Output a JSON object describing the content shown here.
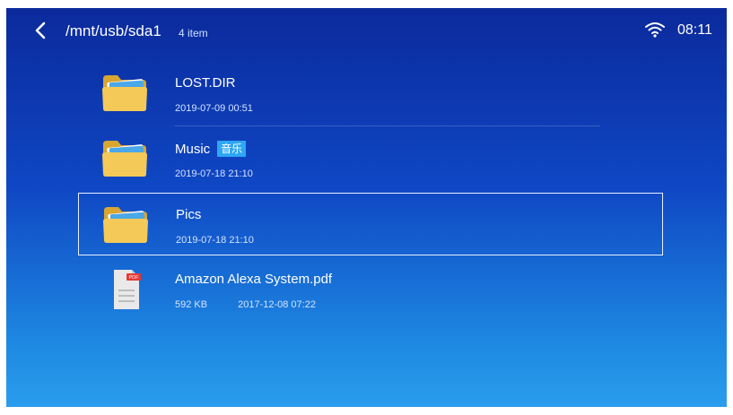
{
  "header": {
    "back_icon": "chevron-left-icon",
    "path": "/mnt/usb/sda1",
    "count": "4 item",
    "wifi_icon": "wifi-icon",
    "time": "08:11"
  },
  "files": [
    {
      "name": "LOST.DIR",
      "type": "folder",
      "date": "2019-07-09 00:51",
      "tag": "",
      "size": ""
    },
    {
      "name": "Music",
      "type": "folder",
      "date": "2019-07-18 21:10",
      "tag": "音乐",
      "size": ""
    },
    {
      "name": "Pics",
      "type": "folder",
      "date": "2019-07-18 21:10",
      "tag": "",
      "size": "",
      "selected": true
    },
    {
      "name": "Amazon Alexa System.pdf",
      "type": "pdf",
      "date": "2017-12-08 07:22",
      "tag": "",
      "size": "592 KB",
      "badge": "PDF"
    }
  ],
  "colors": {
    "background_top": "#0b2a9c",
    "background_bottom": "#2a9ded",
    "tag_bg": "#2ea6f3",
    "folder": "#f2c24f"
  }
}
